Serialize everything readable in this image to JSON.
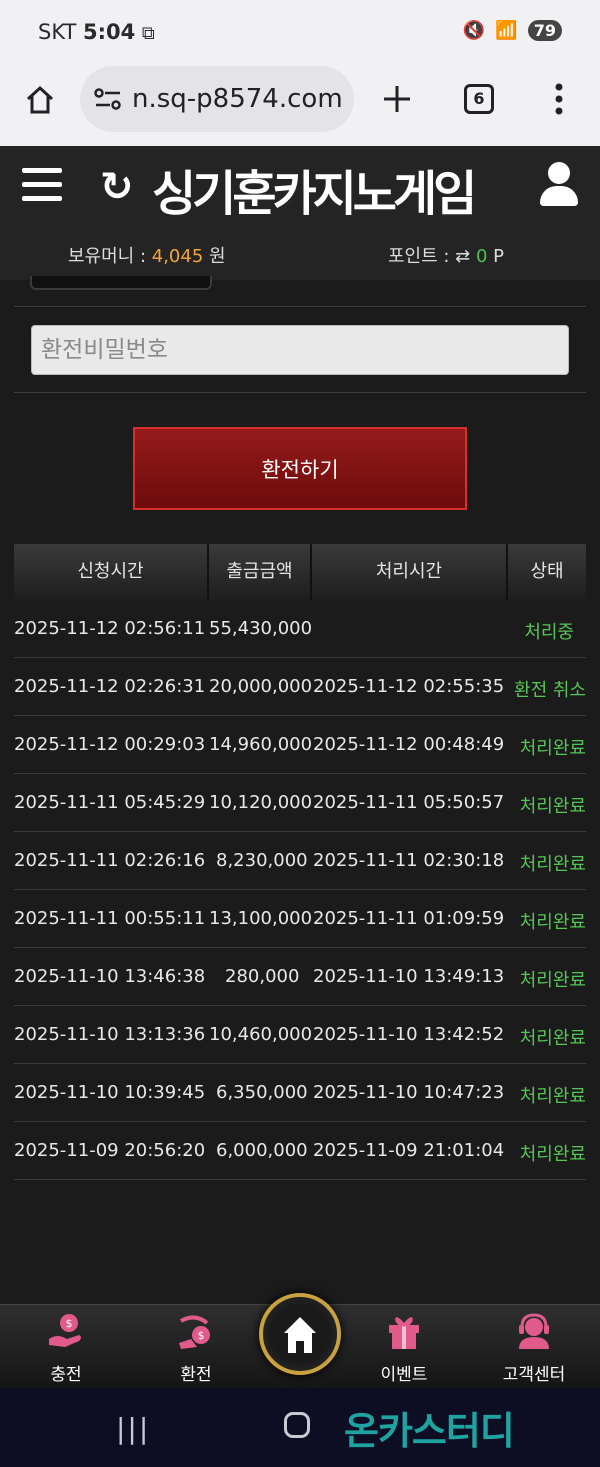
{
  "status_bar": {
    "carrier": "SKT",
    "time": "5:04",
    "battery": "79"
  },
  "browser": {
    "url": "n.sq-p8574.com",
    "tab_count": "6"
  },
  "header": {
    "logo_text": "싱기훈카지노게임",
    "money_label": "보유머니 : ",
    "money_value": "4,045",
    "money_unit": " 원",
    "points_label": "포인트 : ⇄ ",
    "points_value": "0",
    "points_unit": " P"
  },
  "form": {
    "password_placeholder": "환전비밀번호",
    "exchange_button": "환전하기"
  },
  "table": {
    "headers": [
      "신청시간",
      "출금금액",
      "처리시간",
      "상태"
    ],
    "rows": [
      {
        "requested": "2025-11-12 02:56:11",
        "amount": "55,430,000",
        "processed": "",
        "status": "처리중"
      },
      {
        "requested": "2025-11-12 02:26:31",
        "amount": "20,000,000",
        "processed": "2025-11-12 02:55:35",
        "status": "환전 취소"
      },
      {
        "requested": "2025-11-12 00:29:03",
        "amount": "14,960,000",
        "processed": "2025-11-12 00:48:49",
        "status": "처리완료"
      },
      {
        "requested": "2025-11-11 05:45:29",
        "amount": "10,120,000",
        "processed": "2025-11-11 05:50:57",
        "status": "처리완료"
      },
      {
        "requested": "2025-11-11 02:26:16",
        "amount": "8,230,000",
        "processed": "2025-11-11 02:30:18",
        "status": "처리완료"
      },
      {
        "requested": "2025-11-11 00:55:11",
        "amount": "13,100,000",
        "processed": "2025-11-11 01:09:59",
        "status": "처리완료"
      },
      {
        "requested": "2025-11-10 13:46:38",
        "amount": "280,000",
        "processed": "2025-11-10 13:49:13",
        "status": "처리완료"
      },
      {
        "requested": "2025-11-10 13:13:36",
        "amount": "10,460,000",
        "processed": "2025-11-10 13:42:52",
        "status": "처리완료"
      },
      {
        "requested": "2025-11-10 10:39:45",
        "amount": "6,350,000",
        "processed": "2025-11-10 10:47:23",
        "status": "처리완료"
      },
      {
        "requested": "2025-11-09 20:56:20",
        "amount": "6,000,000",
        "processed": "2025-11-09 21:01:04",
        "status": "처리완료"
      }
    ]
  },
  "bottom_nav": {
    "charge": "충전",
    "exchange": "환전",
    "home_icon": "home-icon",
    "event": "이벤트",
    "support": "고객센터"
  },
  "watermark": "온카스터디",
  "colors": {
    "accent_money": "#f2a43a",
    "status_green": "#56c456",
    "button_red": "#951b1b",
    "logo_pink": "#e8407c"
  }
}
